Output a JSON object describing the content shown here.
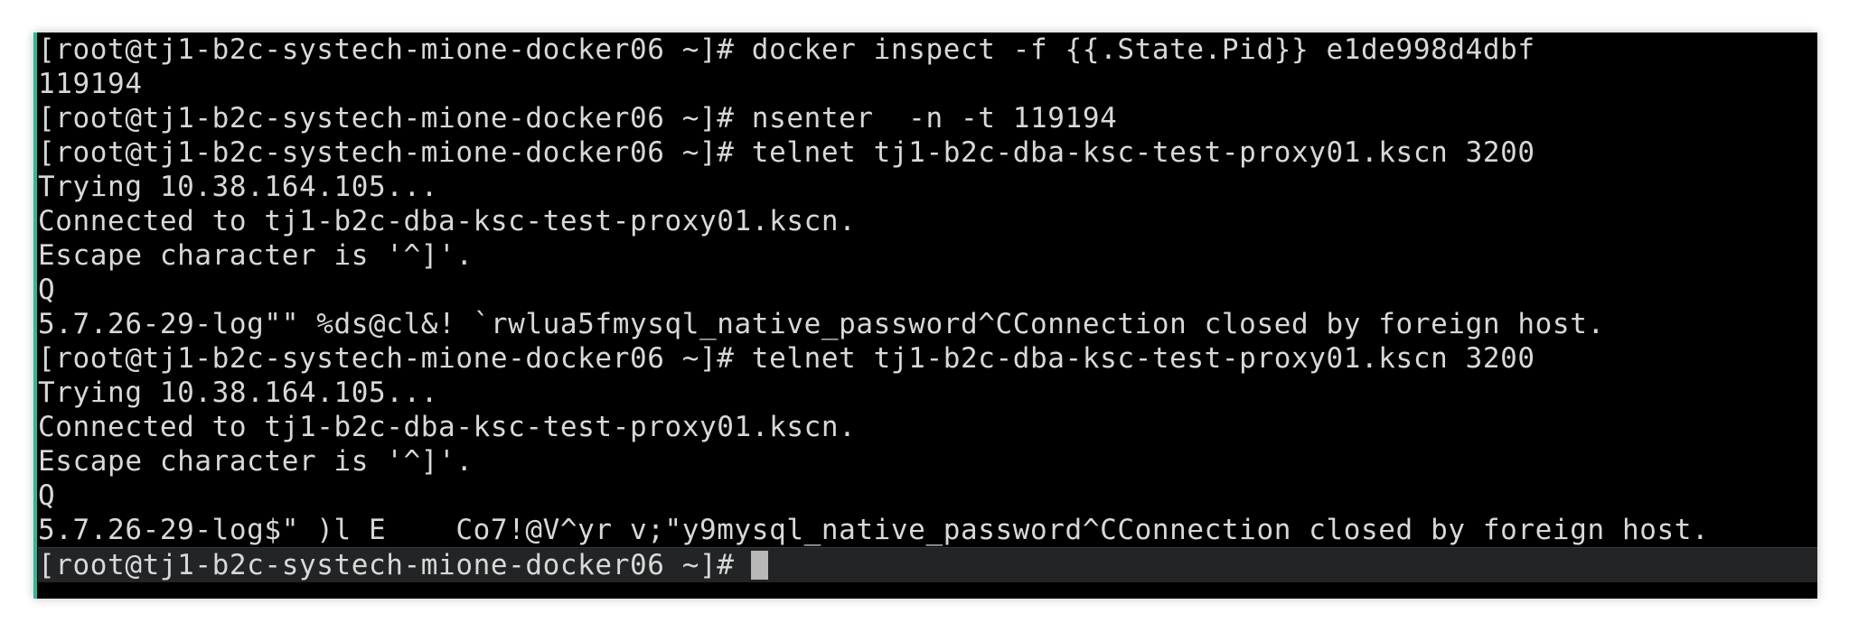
{
  "terminal": {
    "lines": [
      "[root@tj1-b2c-systech-mione-docker06 ~]# docker inspect -f {{.State.Pid}} e1de998d4dbf",
      "119194",
      "[root@tj1-b2c-systech-mione-docker06 ~]# nsenter  -n -t 119194",
      "[root@tj1-b2c-systech-mione-docker06 ~]# telnet tj1-b2c-dba-ksc-test-proxy01.kscn 3200",
      "Trying 10.38.164.105...",
      "Connected to tj1-b2c-dba-ksc-test-proxy01.kscn.",
      "Escape character is '^]'.",
      "Q",
      "5.7.26-29-log\"\" %ds@cl&! `rwlua5fmysql_native_password^CConnection closed by foreign host.",
      "[root@tj1-b2c-systech-mione-docker06 ~]# telnet tj1-b2c-dba-ksc-test-proxy01.kscn 3200",
      "Trying 10.38.164.105...",
      "Connected to tj1-b2c-dba-ksc-test-proxy01.kscn.",
      "Escape character is '^]'.",
      "Q",
      "5.7.26-29-log$\" )l E    Co7!@V^yr v;\"y9mysql_native_password^CConnection closed by foreign host."
    ],
    "prompt": "[root@tj1-b2c-systech-mione-docker06 ~]#"
  },
  "colors": {
    "background": "#000000",
    "text": "#d8d8d8",
    "accent": "#2fb89a",
    "cursor": "#b8b8b8"
  }
}
